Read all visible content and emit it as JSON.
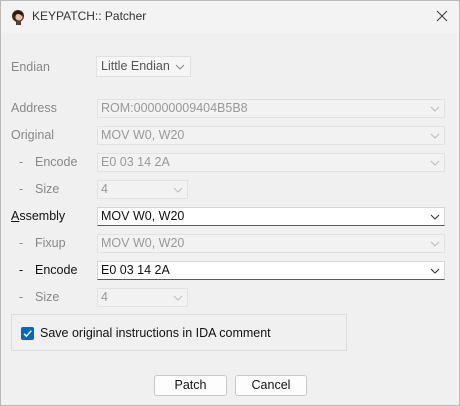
{
  "window": {
    "title": "KEYPATCH:: Patcher"
  },
  "endian": {
    "label": "Endian",
    "value": "Little Endian"
  },
  "address": {
    "label": "Address",
    "value": "ROM:000000009404B5B8"
  },
  "original": {
    "label": "Original",
    "value": "MOV W0, W20",
    "encode_label": "Encode",
    "encode_value": "E0 03 14 2A",
    "size_label": "Size",
    "size_value": "4"
  },
  "assembly": {
    "label_first": "A",
    "label_rest": "ssembly",
    "value": "MOV W0, W20",
    "fixup_label": "Fixup",
    "fixup_value": "MOV W0, W20",
    "encode_label": "Encode",
    "encode_value": "E0 03 14 2A",
    "size_label": "Size",
    "size_value": "4"
  },
  "option": {
    "label": "Save original instructions in IDA comment",
    "checked": true
  },
  "buttons": {
    "patch": "Patch",
    "cancel": "Cancel"
  },
  "colors": {
    "accent": "#0a64c8",
    "disabled_text": "#999999"
  },
  "dash": "-"
}
